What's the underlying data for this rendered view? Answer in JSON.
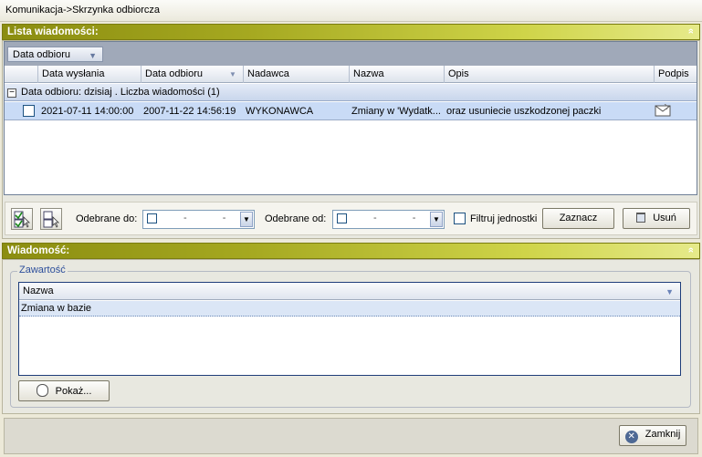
{
  "window": {
    "title": "Komunikacja->Skrzynka odbiorcza"
  },
  "messages_section": {
    "title": "Lista wiadomości:",
    "collapse_symbol": "»"
  },
  "grid": {
    "grouped_by": "Data odbioru",
    "columns": [
      "Data wysłania",
      "Data odbioru",
      "Nadawca",
      "Nazwa",
      "Opis",
      "Podpis"
    ],
    "group_label": "Data odbioru:  dzisiaj . Liczba wiadomości (1)",
    "rows": [
      {
        "sent": "2021-07-11 14:00:00",
        "received": "2007-11-22 14:56:19",
        "sender": "WYKONAWCA",
        "name": "Zmiany  w  'Wydatk...",
        "description": "oraz usuniecie uszkodzonej paczki",
        "signature_icon": "envelope-icon"
      }
    ]
  },
  "filters": {
    "received_to_label": "Odebrane do:",
    "received_from_label": "Odebrane od:",
    "date_placeholder": "-    -",
    "filter_units_label": "Filtruj jednostki",
    "select_button": "Zaznacz",
    "delete_button": "Usuń"
  },
  "message_section": {
    "title": "Wiadomość:",
    "collapse_symbol": "»",
    "content_legend": "Zawartość",
    "list_header": "Nazwa",
    "items": [
      "Zmiana w bazie"
    ],
    "show_button": "Pokaż..."
  },
  "footer": {
    "close_button": "Zamknij"
  },
  "colors": {
    "section_header": "#a5a820",
    "selected_row": "#c9dbf6",
    "grid_border": "#6f7f96"
  }
}
